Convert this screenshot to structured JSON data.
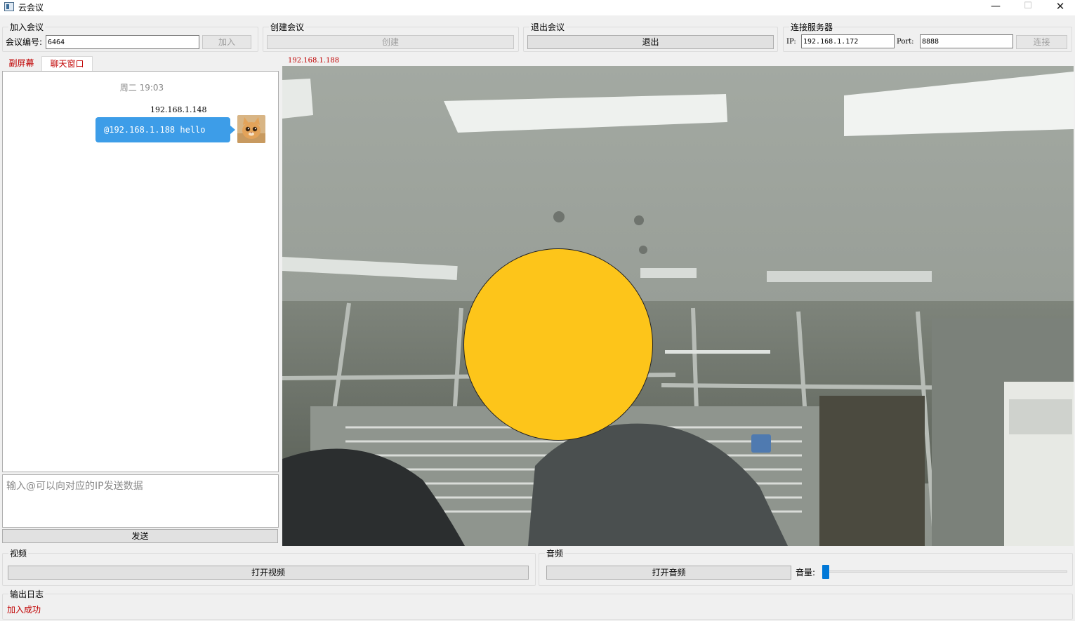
{
  "window": {
    "title": "云会议",
    "minimize": "—",
    "maximize": "☐",
    "close": "✕"
  },
  "join_group": {
    "title": "加入会议",
    "id_label": "会议编号:",
    "id_value": "6464",
    "join_button": "加入"
  },
  "create_group": {
    "title": "创建会议",
    "create_button": "创建"
  },
  "exit_group": {
    "title": "退出会议",
    "exit_button": "退出"
  },
  "server_group": {
    "title": "连接服务器",
    "ip_label": "IP:",
    "ip_value": "192.168.1.172",
    "port_label": "Port:",
    "port_value": "8888",
    "connect_button": "连接"
  },
  "tabs": [
    {
      "label": "副屏幕"
    },
    {
      "label": "聊天窗口"
    }
  ],
  "chat": {
    "timestamp": "周二 19:03",
    "messages": [
      {
        "sender": "192.168.1.148",
        "text": "@192.168.1.188  hello",
        "avatar": "cat-avatar"
      }
    ],
    "input_placeholder": "输入@可以向对应的IP发送数据",
    "send_button": "发送"
  },
  "video": {
    "source_label": "192.168.1.188"
  },
  "video_group": {
    "title": "视频",
    "open_button": "打开视频"
  },
  "audio_group": {
    "title": "音频",
    "open_button": "打开音频",
    "volume_label": "音量:",
    "volume_level": 0
  },
  "log_group": {
    "title": "输出日志",
    "entries": [
      "加入成功"
    ]
  },
  "colors": {
    "accent_red": "#c00000",
    "bubble_blue": "#3d9de8",
    "face_cover": "#fdc51a",
    "slider_blue": "#0078d7"
  }
}
